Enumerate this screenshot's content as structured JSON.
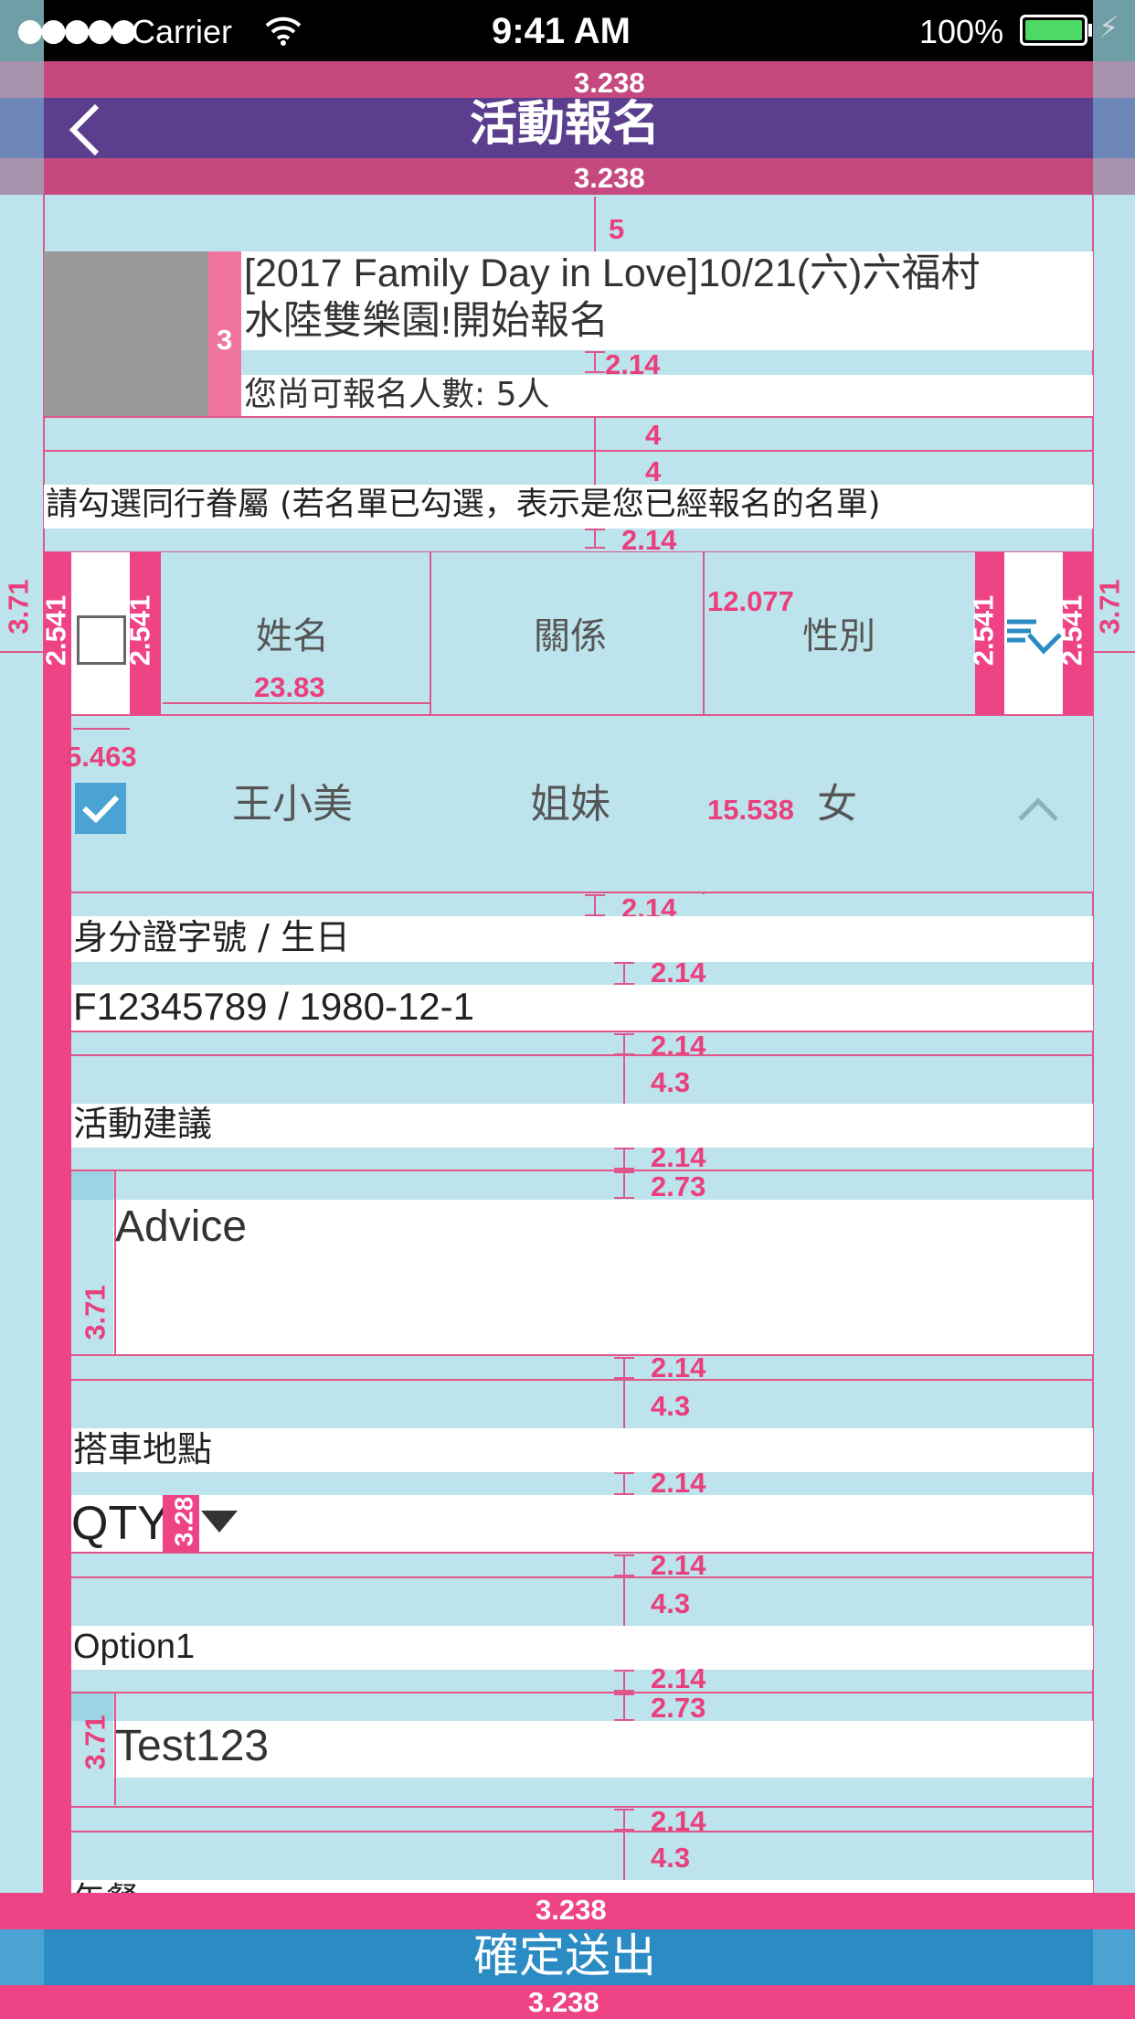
{
  "status_bar": {
    "signal": "●●●●●",
    "carrier": "Carrier",
    "time": "9:41 AM",
    "battery": "100%"
  },
  "nav": {
    "title": "活動報名",
    "back_icon": "chevron-left-icon"
  },
  "event": {
    "title_line1": "[2017 Family Day in Love]10/21(六)六福村",
    "title_line2": "水陸雙樂園!開始報名",
    "quota": "您尚可報名人數: 5人"
  },
  "instruction": "請勾選同行眷屬 (若名單已勾選，表示是您已經報名的名單)",
  "table": {
    "headers": [
      "姓名",
      "關係",
      "性別"
    ],
    "rows": [
      {
        "name": "王小美",
        "relation": "姐妹",
        "gender": "女",
        "checked": true
      }
    ]
  },
  "id_section": {
    "label": "身分證字號 / 生日",
    "value": "F12345789 / 1980-12-1"
  },
  "advice_section": {
    "label": "活動建議",
    "placeholder": "Advice"
  },
  "pickup_section": {
    "label": "搭車地點",
    "value": "QTY"
  },
  "option_section": {
    "label": "Option1",
    "value": "Test123"
  },
  "cut_label": "午餐",
  "submit": {
    "label": "確定送出"
  },
  "annotations": {
    "a3238": "3.238",
    "a5": "5",
    "a3": "3",
    "a214": "2.14",
    "a4": "4",
    "a371": "3.71",
    "a2541": "2.541",
    "a12077": "12.077",
    "a2383": "23.83",
    "a5463": "5.463",
    "a15538": "15.538",
    "a43": "4.3",
    "a273": "2.73",
    "a328": "3.28"
  },
  "colors": {
    "nav": "#5b3f8e",
    "accent_pink": "#ee4385",
    "submit": "#2b8bc3",
    "bg": "#bde3ec"
  }
}
